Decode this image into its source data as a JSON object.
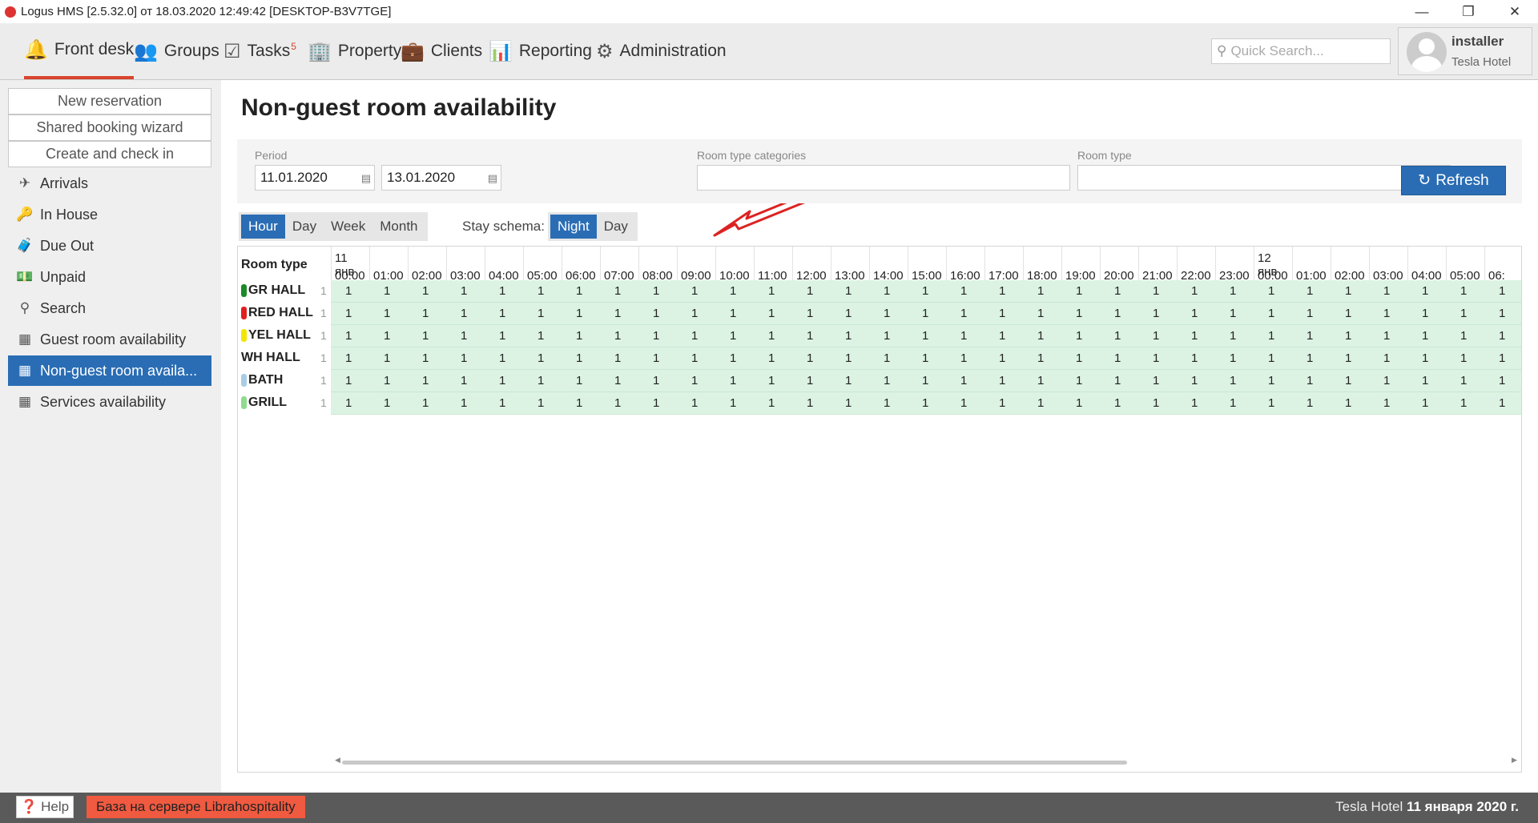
{
  "window": {
    "title": "Logus HMS [2.5.32.0] от 18.03.2020 12:49:42 [DESKTOP-B3V7TGE]"
  },
  "nav": [
    {
      "label": "Front desk",
      "icon": "bell-icon",
      "active": true
    },
    {
      "label": "Groups",
      "icon": "users-icon"
    },
    {
      "label": "Tasks",
      "icon": "calendar-check-icon",
      "badge": "5"
    },
    {
      "label": "Property",
      "icon": "building-icon"
    },
    {
      "label": "Clients",
      "icon": "briefcase-icon"
    },
    {
      "label": "Reporting",
      "icon": "bar-chart-icon"
    },
    {
      "label": "Administration",
      "icon": "gears-icon"
    }
  ],
  "search": {
    "placeholder": "Quick Search..."
  },
  "user": {
    "name": "installer",
    "hotel": "Tesla Hotel"
  },
  "sidebar": {
    "buttons": [
      "New reservation",
      "Shared booking wizard",
      "Create and check in"
    ],
    "items": [
      {
        "label": "Arrivals",
        "icon": "plane-icon"
      },
      {
        "label": "In House",
        "icon": "key-icon"
      },
      {
        "label": "Due Out",
        "icon": "suitcase-icon"
      },
      {
        "label": "Unpaid",
        "icon": "money-icon"
      },
      {
        "label": "Search",
        "icon": "search-icon"
      },
      {
        "label": "Guest room availability",
        "icon": "grid-icon"
      },
      {
        "label": "Non-guest room availa...",
        "icon": "grid-icon",
        "active": true
      },
      {
        "label": "Services availability",
        "icon": "grid-icon"
      }
    ]
  },
  "page": {
    "title": "Non-guest room availability"
  },
  "filters": {
    "period_label": "Period",
    "date_from": "11.01.2020",
    "date_to": "13.01.2020",
    "categories_label": "Room type categories",
    "room_type_label": "Room type",
    "refresh_label": "Refresh"
  },
  "scale": {
    "options": [
      "Hour",
      "Day",
      "Week",
      "Month"
    ],
    "selected": "Hour"
  },
  "stay": {
    "label": "Stay schema:",
    "options": [
      "Night",
      "Day"
    ],
    "selected": "Night"
  },
  "grid": {
    "room_type_header": "Room type",
    "columns": [
      {
        "date": "11 янв",
        "time": "00:00"
      },
      {
        "time": "01:00"
      },
      {
        "time": "02:00"
      },
      {
        "time": "03:00"
      },
      {
        "time": "04:00"
      },
      {
        "time": "05:00"
      },
      {
        "time": "06:00"
      },
      {
        "time": "07:00"
      },
      {
        "time": "08:00"
      },
      {
        "time": "09:00"
      },
      {
        "time": "10:00"
      },
      {
        "time": "11:00"
      },
      {
        "time": "12:00"
      },
      {
        "time": "13:00"
      },
      {
        "time": "14:00"
      },
      {
        "time": "15:00"
      },
      {
        "time": "16:00"
      },
      {
        "time": "17:00"
      },
      {
        "time": "18:00"
      },
      {
        "time": "19:00"
      },
      {
        "time": "20:00"
      },
      {
        "time": "21:00"
      },
      {
        "time": "22:00"
      },
      {
        "time": "23:00"
      },
      {
        "date": "12 янв",
        "time": "00:00"
      },
      {
        "time": "01:00"
      },
      {
        "time": "02:00"
      },
      {
        "time": "03:00"
      },
      {
        "time": "04:00"
      },
      {
        "time": "05:00"
      },
      {
        "time": "06:"
      }
    ],
    "rows": [
      {
        "name": "GR HALL",
        "color": "#1a8a2a",
        "count": "1",
        "value": "1"
      },
      {
        "name": "RED HALL",
        "color": "#e02020",
        "count": "1",
        "value": "1"
      },
      {
        "name": "YEL HALL",
        "color": "#f2e600",
        "count": "1",
        "value": "1"
      },
      {
        "name": "WH HALL",
        "color": "",
        "count": "1",
        "value": "1"
      },
      {
        "name": "BATH",
        "color": "#a9cde6",
        "count": "1",
        "value": "1"
      },
      {
        "name": "GRILL",
        "color": "#8fdb8f",
        "count": "1",
        "value": "1"
      }
    ]
  },
  "status": {
    "help": "Help",
    "db": "База на сервере Librahospitality",
    "hotel": "Tesla Hotel",
    "date": "11 января 2020 г."
  }
}
